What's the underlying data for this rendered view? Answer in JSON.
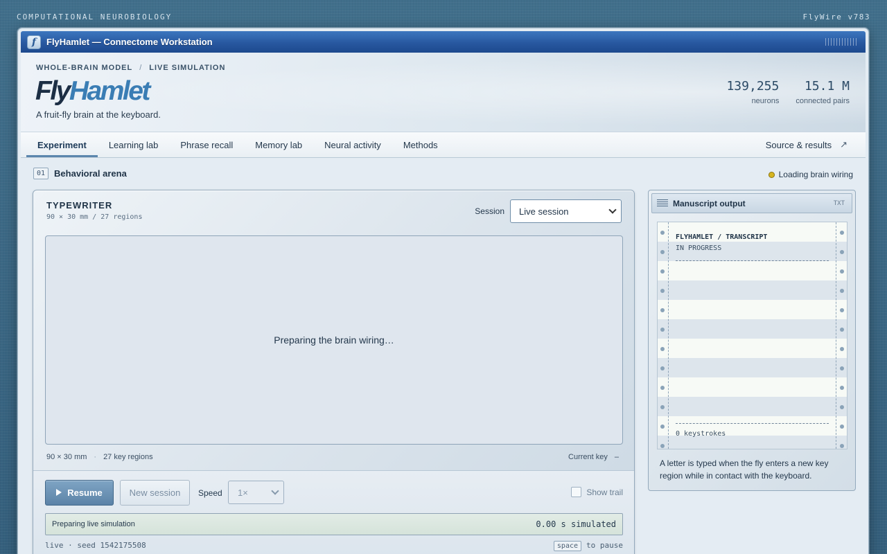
{
  "topbar": {
    "left": "COMPUTATIONAL NEUROBIOLOGY",
    "right": "FlyWire v783"
  },
  "window": {
    "title": "FlyHamlet — Connectome Workstation",
    "icon": "f"
  },
  "hero": {
    "breadcrumb": [
      "WHOLE-BRAIN MODEL",
      "LIVE SIMULATION"
    ],
    "breadcrumb_sep": "/",
    "brand_a": "Fly",
    "brand_b": "Hamlet",
    "tagline": "A fruit-fly brain at the keyboard.",
    "stats": [
      {
        "value": "139,255",
        "label": "neurons"
      },
      {
        "value": "15.1 M",
        "label": "connected pairs"
      }
    ]
  },
  "tabs": [
    {
      "label": "Experiment",
      "active": true
    },
    {
      "label": "Learning lab"
    },
    {
      "label": "Phrase recall"
    },
    {
      "label": "Memory lab"
    },
    {
      "label": "Neural activity"
    },
    {
      "label": "Methods"
    }
  ],
  "source_link": {
    "label": "Source & results",
    "arrow": "↗"
  },
  "section": {
    "number": "01",
    "title": "Behavioral arena",
    "status": "Loading brain wiring",
    "status_color": "#d6b520"
  },
  "arena": {
    "title": "TYPEWRITER",
    "subtitle": "90 × 30 mm / 27 regions",
    "session_label": "Session",
    "session_value": "Live session",
    "canvas_message": "Preparing the brain wiring…",
    "meta_size": "90 × 30 mm",
    "meta_dot": "·",
    "meta_regions": "27 key regions",
    "current_key_label": "Current key",
    "current_key_value": "–"
  },
  "controls": {
    "resume_label": "Resume",
    "new_session_label": "New session",
    "speed_label": "Speed",
    "speed_value": "1×",
    "show_trail_label": "Show trail",
    "show_trail_checked": false,
    "status_message": "Preparing live simulation",
    "simulated": "0.00 s simulated",
    "footer_left": "live · seed 1542175508",
    "kbd_key": "space",
    "kbd_hint": "to pause"
  },
  "manuscript": {
    "title": "Manuscript output",
    "tag": "TXT",
    "paper_title": "FLYHAMLET / TRANSCRIPT",
    "paper_status": "IN PROGRESS",
    "keystrokes": "0 keystrokes",
    "note": "A letter is typed when the fly enters a new key region while in contact with the keyboard."
  },
  "colors": {
    "accent": "#3a7db4",
    "titlebar": "#2858a0",
    "brand_dark": "#1c2e44"
  }
}
